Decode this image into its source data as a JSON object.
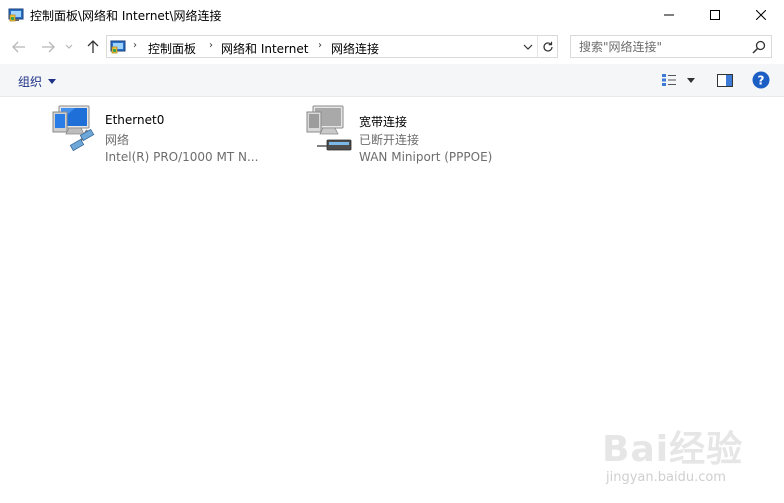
{
  "window": {
    "title": "控制面板\\网络和 Internet\\网络连接"
  },
  "address_bar": {
    "breadcrumbs": [
      "控制面板",
      "网络和 Internet",
      "网络连接"
    ]
  },
  "search": {
    "placeholder": "搜索\"网络连接\""
  },
  "toolbar": {
    "organize_label": "组织"
  },
  "connections": [
    {
      "name": "Ethernet0",
      "status": "网络",
      "device": "Intel(R) PRO/1000 MT N...",
      "icon": "ethernet-adapter-icon"
    },
    {
      "name": "宽带连接",
      "status": "已断开连接",
      "device": "WAN Miniport (PPPOE)",
      "icon": "broadband-adapter-icon"
    }
  ],
  "watermark": {
    "brand": "Bai经验",
    "url": "jingyan.baidu.com"
  },
  "colors": {
    "command_bar_bg": "#f5f6f7",
    "link_blue": "#1e3287",
    "help_blue": "#1c5fc4",
    "secondary_text": "#6d6d6d"
  }
}
